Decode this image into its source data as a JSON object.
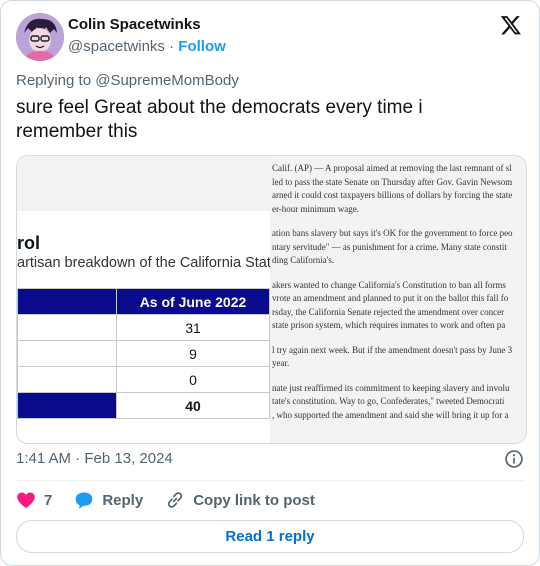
{
  "author": {
    "name": "Colin Spacetwinks",
    "handle": "@spacetwinks",
    "separator": "·",
    "follow_label": "Follow"
  },
  "replying_to": "Replying to @SupremeMomBody",
  "tweet_text": "sure feel Great about the democrats every time i remember this",
  "media": {
    "left": {
      "title_fragment": "rol",
      "subtitle_fragment": "artisan breakdown of the California State",
      "table": {
        "header": "As of June 2022",
        "values": [
          "31",
          "9",
          "0",
          "40"
        ]
      }
    },
    "right": {
      "lines": [
        "Calif. (AP) — A proposal aimed at removing the last remnant of sl",
        "led to pass the state Senate on Thursday after Gov. Gavin Newsom",
        "arned it could cost taxpayers billions of dollars by forcing the state",
        "er-hour minimum wage.",
        "",
        "ation bans slavery but says it's OK for the government to force peo",
        "ntary servitude\" — as punishment for a crime. Many state constit",
        "ding California's.",
        "",
        "akers wanted to change California's Constitution to ban all forms",
        "vrote an amendment and planned to put it on the ballot this fall fo",
        "rsday, the California Senate rejected the amendment over concer",
        "state prison system, which requires inmates to work and often pa",
        "",
        "l try again next week. But if the amendment doesn't pass by June 3",
        "year.",
        "",
        "nate just reaffirmed its commitment to keeping slavery and involu",
        "tate's constitution. Way to go, Confederates,\" tweeted Democrati",
        ", who supported the amendment and said she will bring it up for a"
      ]
    }
  },
  "timestamp": "1:41 AM · Feb 13, 2024",
  "actions": {
    "likes": "7",
    "reply_label": "Reply",
    "copy_label": "Copy link to post"
  },
  "read_replies_label": "Read 1 reply",
  "colors": {
    "accent": "#1d9bf0",
    "like": "#f91880",
    "table_header": "#0a0a8c"
  },
  "icons": [
    "x-logo-icon",
    "info-icon",
    "heart-icon",
    "reply-bubble-icon",
    "link-icon"
  ]
}
